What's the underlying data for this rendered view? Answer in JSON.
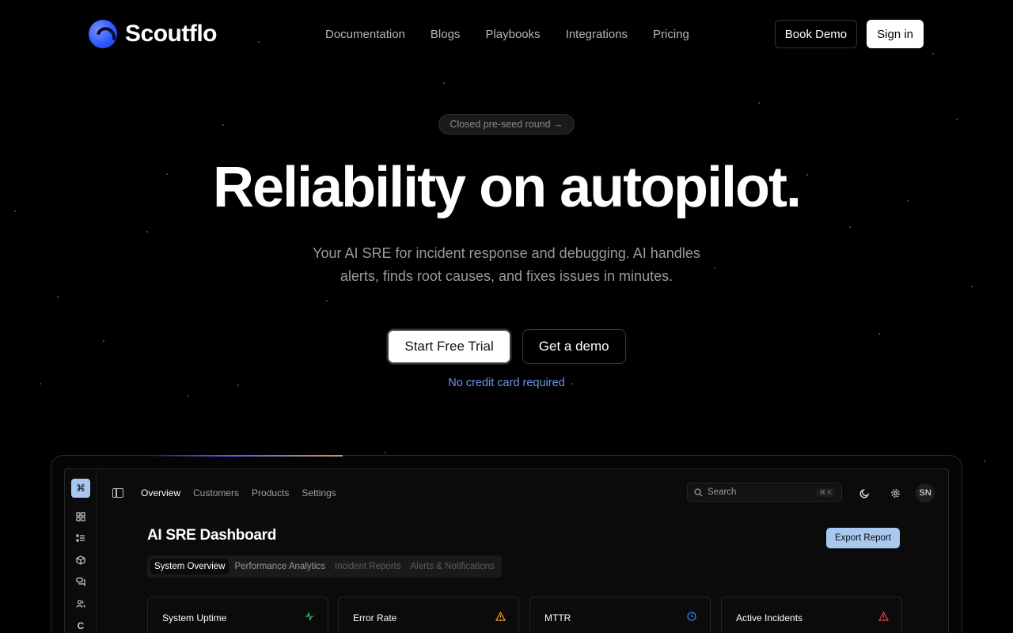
{
  "brand": {
    "name": "Scoutflo"
  },
  "nav": {
    "links": [
      "Documentation",
      "Blogs",
      "Playbooks",
      "Integrations",
      "Pricing"
    ],
    "book_demo": "Book Demo",
    "sign_in": "Sign in"
  },
  "hero": {
    "pill": "Closed pre-seed round →",
    "headline": "Reliability on autopilot.",
    "subtitle": "Your AI SRE for incident response and debugging. AI handles alerts, finds root causes, and fixes issues in minutes.",
    "cta_primary": "Start Free Trial",
    "cta_secondary": "Get a demo",
    "note": "No credit card required",
    "note_color": "#6b95e8"
  },
  "dashboard": {
    "sidebar_icons": [
      "command-icon",
      "grid-icon",
      "list-icon",
      "box-icon",
      "chat-icon",
      "users-icon",
      "logo-icon"
    ],
    "tabs": [
      "Overview",
      "Customers",
      "Products",
      "Settings"
    ],
    "search_placeholder": "Search",
    "search_shortcut": "⌘ K",
    "avatar": "SN",
    "title": "AI SRE Dashboard",
    "export_label": "Export Report",
    "subtabs": [
      "System Overview",
      "Performance Analytics",
      "Incident Reports",
      "Alerts & Notifications"
    ],
    "cards": [
      {
        "title": "System Uptime",
        "icon": "activity-icon",
        "icon_color": "#22c55e"
      },
      {
        "title": "Error Rate",
        "icon": "warning-icon",
        "icon_color": "#f5a524"
      },
      {
        "title": "MTTR",
        "icon": "clock-icon",
        "icon_color": "#3b82f6"
      },
      {
        "title": "Active Incidents",
        "icon": "alert-icon",
        "icon_color": "#ef4444"
      }
    ],
    "accent_color": "#a9c8ef"
  }
}
